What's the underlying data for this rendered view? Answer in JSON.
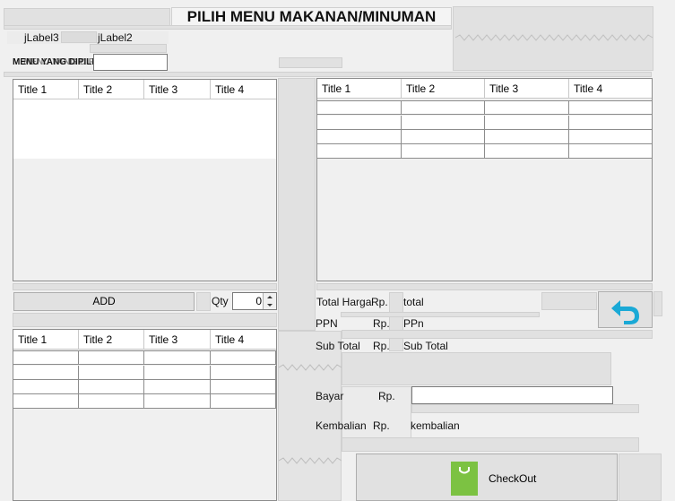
{
  "title": "PILIH MENU MAKANAN/MINUMAN",
  "labels": {
    "jlabel3": "jLabel3",
    "jlabel2": "jLabel2",
    "menu_yang_dipilih": "MENU YANG DIPILIH",
    "menu_yang_dipilih_overlap": "MENU YANG DIPILIH"
  },
  "tables": {
    "top_left": {
      "columns": [
        "Title 1",
        "Title 2",
        "Title 3",
        "Title 4"
      ]
    },
    "top_right": {
      "columns": [
        "Title 1",
        "Title 2",
        "Title 3",
        "Title 4"
      ],
      "rows": 4
    },
    "bottom_left": {
      "columns": [
        "Title 1",
        "Title 2",
        "Title 3",
        "Title 4"
      ],
      "rows": 4
    }
  },
  "add_button": "ADD",
  "qty": {
    "label": "Qty",
    "value": "0"
  },
  "summary": {
    "total_harga": "Total Harga",
    "rp": "Rp.",
    "total": "total",
    "ppn": "PPN",
    "ppn_value": "PPn",
    "sub_total": "Sub Total",
    "sub_total_value": "Sub Total",
    "bayar": "Bayar",
    "kembalian": "Kembalian",
    "kembalian_value": "kembalian"
  },
  "checkout_label": "CheckOut",
  "colors": {
    "back_arrow": "#1aa9d6",
    "bag_icon": "#7cc242"
  }
}
